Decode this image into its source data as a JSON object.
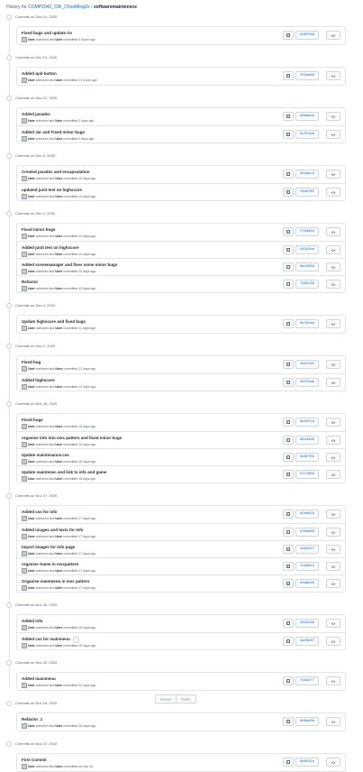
{
  "breadcrumb": {
    "prefix": "History for",
    "repo": "COMP2042_CW_ChooMingZe",
    "separator": "/",
    "path": "softwaremaintenece"
  },
  "groups": [
    {
      "date": "Commits on Dec 14, 2020",
      "commits": [
        {
          "title": "Fixed bugs and update rio",
          "meta": "committed 9 hours ago",
          "sha": "6d8f58b"
        }
      ]
    },
    {
      "date": "Commits on Dec 13, 2020",
      "commits": [
        {
          "title": "Added quit button",
          "meta": "committed 21 hours ago",
          "sha": "f02da69"
        }
      ]
    },
    {
      "date": "Commits on Dec 12, 2020",
      "commits": [
        {
          "title": "Added javadoc",
          "meta": "committed 2 days ago",
          "sha": "b0b8eeb"
        },
        {
          "title": "Added Jar and Fixed minor bugs",
          "meta": "committed 2 days ago",
          "sha": "6cff2a6"
        }
      ]
    },
    {
      "date": "Commits on Dec 5, 2020",
      "commits": [
        {
          "title": "Created javadoc and encapsulation",
          "meta": "committed 10 days ago",
          "sha": "2b1aec3"
        },
        {
          "title": "updated junit test on highscore",
          "meta": "committed 10 days ago",
          "sha": "f8cb78f"
        }
      ]
    },
    {
      "date": "Commits on Dec 4, 2020",
      "commits": [
        {
          "title": "Fixed minor bugs",
          "meta": "committed 10 days ago",
          "sha": "f70d62d"
        },
        {
          "title": "Added junit test on highscore",
          "meta": "committed 10 days ago",
          "sha": "d4342be"
        },
        {
          "title": "Added scenemanager and fixes some minor bugs",
          "meta": "committed 10 days ago",
          "sha": "8a4f68d"
        },
        {
          "title": "Refactor",
          "meta": "committed 10 days ago",
          "sha": "7985128"
        }
      ]
    },
    {
      "date": "Commits on Dec 3, 2020",
      "commits": [
        {
          "title": "Update highscore and fixed bugs",
          "meta": "committed 11 days ago",
          "sha": "3e7bfae"
        }
      ]
    },
    {
      "date": "Commits on Dec 2, 2020",
      "commits": [
        {
          "title": "Fixed bug",
          "meta": "committed 12 days ago",
          "sha": "49ef10f"
        },
        {
          "title": "Added highscore",
          "meta": "committed 12 days ago",
          "sha": "58ff5ae"
        }
      ]
    },
    {
      "date": "Commits on Nov 28, 2020",
      "commits": [
        {
          "title": "Fixed bugs",
          "meta": "committed 16 days ago",
          "sha": "9b32fcd"
        },
        {
          "title": "organise info into mvc pattern and fixed minor bugs",
          "meta": "committed 16 days ago",
          "sha": "d6c9485"
        },
        {
          "title": "Update maintenance.css",
          "meta": "committed 16 days ago",
          "sha": "9e8f75b"
        },
        {
          "title": "Update maintenec and link to info and game",
          "meta": "committed 16 days ago",
          "sha": "d717882"
        }
      ]
    },
    {
      "date": "Commits on Nov 27, 2020",
      "commits": [
        {
          "title": "Added css for info",
          "meta": "committed 17 days ago",
          "sha": "b5eb878"
        },
        {
          "title": "Added images and texts for Info",
          "meta": "committed 17 days ago",
          "sha": "df9be68"
        },
        {
          "title": "import images for info page",
          "meta": "committed 17 days ago",
          "sha": "2db251f"
        },
        {
          "title": "organise Game in mvcpattern",
          "meta": "committed 17 days ago",
          "sha": "7de9612"
        },
        {
          "title": "Organise mainmenu in mvc pattern",
          "meta": "committed 17 days ago",
          "sha": "e1a6b46"
        }
      ]
    },
    {
      "date": "Commits on Nov 26, 2020",
      "commits": [
        {
          "title": "Added info",
          "meta": "committed 18 days ago",
          "sha": "3332c99"
        },
        {
          "title": "Added css for mainmenu",
          "meta": "committed 18 days ago",
          "sha": "4af6b47",
          "badge": "..."
        }
      ]
    },
    {
      "date": "Commits on Nov 22, 2020",
      "commits": [
        {
          "title": "Added mainmenu",
          "meta": "committed 22 days ago",
          "sha": "f1a4c77"
        }
      ]
    },
    {
      "date": "Commits on Nov 18, 2020",
      "commits": [
        {
          "title": "Refactor_1",
          "meta": "committed 26 days ago",
          "sha": "9d8bd0e"
        }
      ]
    },
    {
      "date": "Commits on Nov 10, 2020",
      "commits": [
        {
          "title": "First Commit",
          "meta": "committed on Nov 10",
          "sha": "9e9f21a"
        }
      ]
    }
  ],
  "author": {
    "user": "User",
    "joiner": "authored and",
    "committer": "User"
  },
  "pagination": {
    "newer": "Newer",
    "older": "Older"
  },
  "colors": {
    "link": "#0366d6",
    "border": "#e1e4e8",
    "muted": "#586069"
  },
  "icons": {
    "copy": "clipboard-icon",
    "browse": "code-icon",
    "dot": "commit-dot-icon"
  }
}
